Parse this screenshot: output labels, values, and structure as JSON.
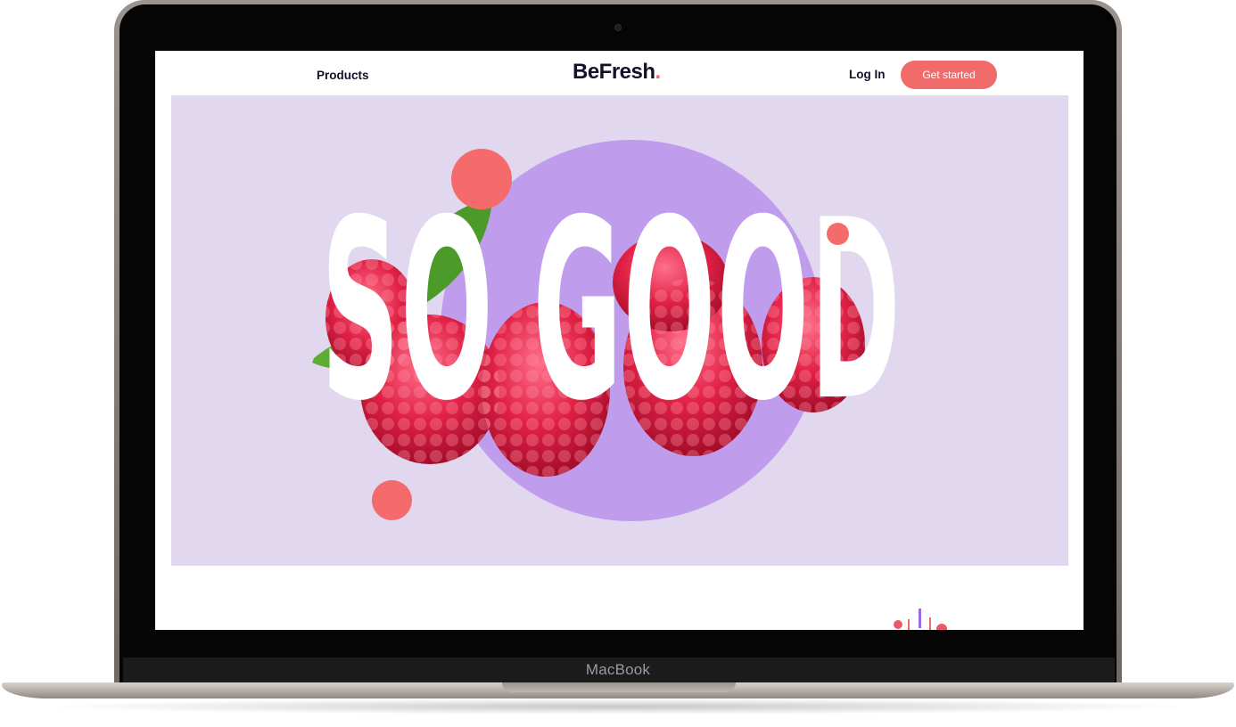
{
  "device": {
    "brand_label": "MacBook"
  },
  "nav": {
    "products_label": "Products",
    "login_label": "Log In",
    "cta_label": "Get started"
  },
  "logo": {
    "text": "BeFresh",
    "dot": "."
  },
  "hero": {
    "headline": "SO GOOD",
    "background_color": "#e1d8f0",
    "circle_color": "#c09ced",
    "accent_dot_color": "#f56b6b",
    "image_subject": "raspberries"
  },
  "colors": {
    "accent": "#f26b6b",
    "text": "#14112a"
  }
}
